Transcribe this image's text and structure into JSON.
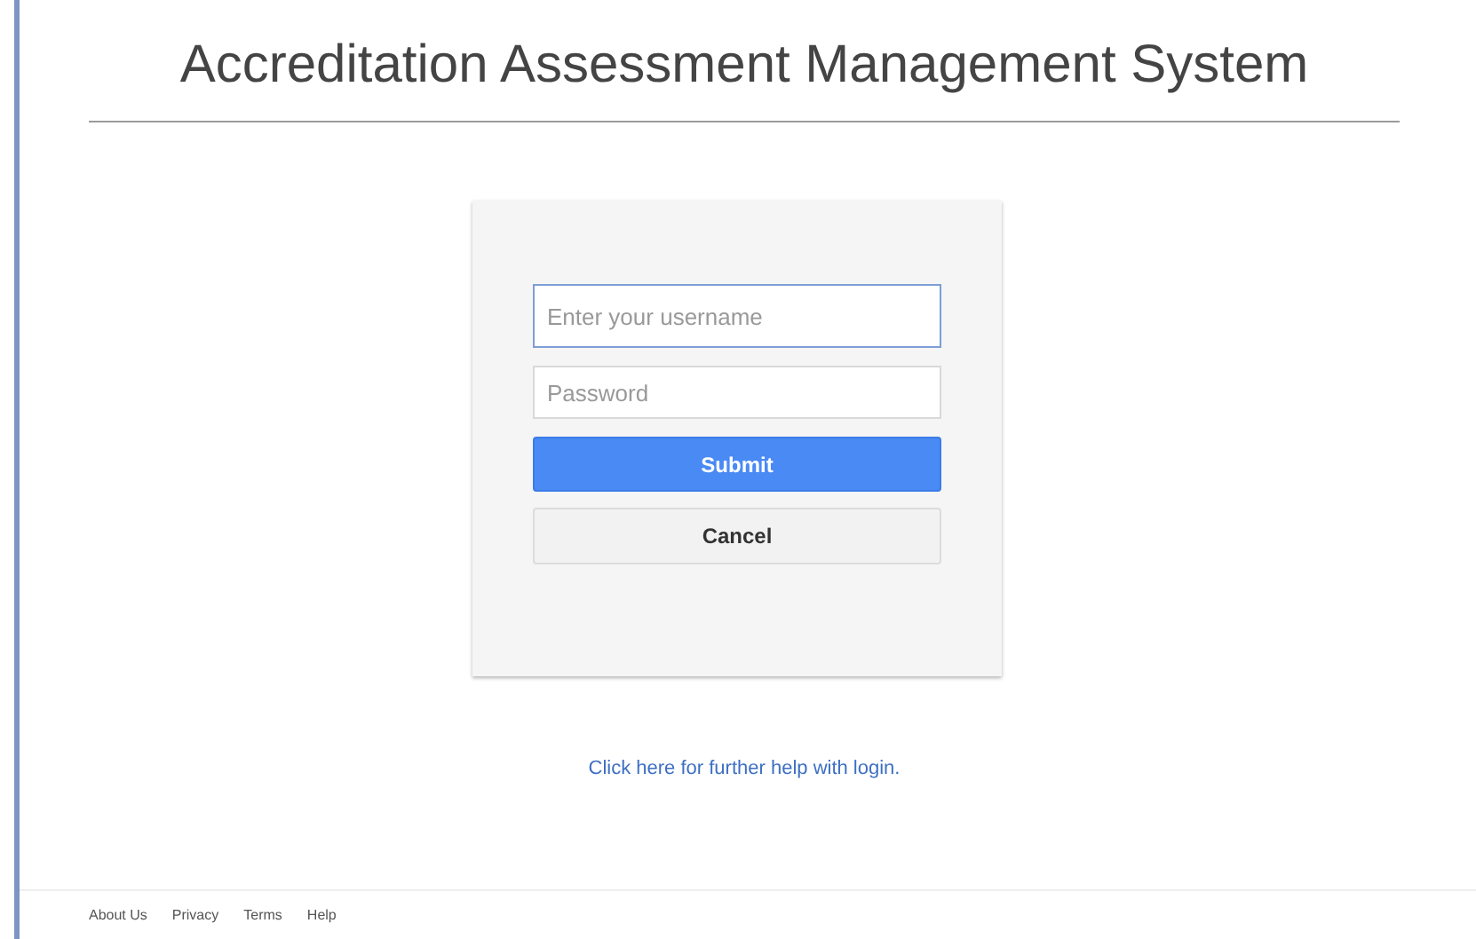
{
  "header": {
    "title": "Accreditation Assessment Management System"
  },
  "login_form": {
    "fields": [
      {
        "placeholder": "Enter your username",
        "focused": true
      },
      {
        "placeholder": "Password",
        "focused": false
      }
    ],
    "buttons": [
      {
        "label": "Submit",
        "kind": "primary"
      },
      {
        "label": "Cancel",
        "kind": "secondary"
      }
    ]
  },
  "help_link": "Click here for further help with login.",
  "footer": {
    "links": [
      "About Us",
      "Privacy",
      "Terms",
      "Help"
    ]
  }
}
